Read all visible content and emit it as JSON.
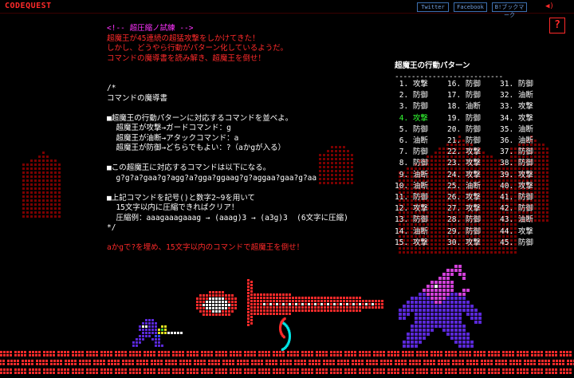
{
  "header": {
    "logo": "CODEQUEST",
    "share": {
      "twitter": "Twitter",
      "facebook": "Facebook",
      "bookmark": "B!ブックマーク"
    },
    "sound_icon": "speaker-icon",
    "help_label": "?"
  },
  "briefing": {
    "comment": "<!-- 超圧縮ノ試練 -->",
    "story": [
      "超魔王が45連続の超猛攻撃をしかけてきた！",
      "しかし、どうやら行動がパターン化しているようだ。",
      "コマンドの魔導書を読み解き、超魔王を倒せ！"
    ],
    "code": [
      "/*",
      "コマンドの魔導書",
      "",
      "■超魔王の行動パターンに対応するコマンドを並べよ。",
      "  超魔王が攻撃→ガードコマンド：g",
      "  超魔王が油断→アタックコマンド：a",
      "  超魔王が防御→どちらでもよい：?（aかgが入る）",
      "",
      "■この超魔王に対応するコマンドは以下になる。",
      "  g?g?a?gaa?g?agg?a?gga?ggaag?g?aggaa?gaa?g?aa",
      "",
      "■上記コマンドを記号()と数字2~9を用いて",
      "  15文字以内に圧縮できればクリア！",
      "  圧縮例：aaagaaagaaag → (aaag)3 → (a3g)3  (6文字に圧縮)",
      "*/"
    ],
    "goal": "aかgで?を埋め、15文字以内のコマンドで超魔王を倒せ！"
  },
  "pattern": {
    "title": "超魔王の行動パターン",
    "rule": "--------------------------",
    "current": 4,
    "columns": [
      [
        "攻撃",
        "防御",
        "防御",
        "攻撃",
        "防御",
        "油断",
        "防御",
        "防御",
        "油断",
        "油断",
        "防御",
        "攻撃",
        "防御",
        "油断",
        "攻撃"
      ],
      [
        "防御",
        "防御",
        "油断",
        "防御",
        "防御",
        "防御",
        "攻撃",
        "攻撃",
        "攻撃",
        "油断",
        "攻撃",
        "攻撃",
        "防御",
        "防御",
        "攻撃"
      ],
      [
        "防御",
        "油断",
        "攻撃",
        "攻撃",
        "油断",
        "油断",
        "防御",
        "防御",
        "攻撃",
        "攻撃",
        "防御",
        "防御",
        "油断",
        "攻撃",
        "防御"
      ]
    ]
  },
  "colors": {
    "red": "#ff2a2a",
    "dark_red": "#7a0000",
    "magenta": "#ff33ff",
    "highlight_green": "#33ff33",
    "boss_purple": "#5a28d8",
    "boss_pink": "#d040d8",
    "sword_cyan": "#00e5e5",
    "hero_purple": "#5a28d8",
    "hero_yellow": "#e0e020"
  }
}
